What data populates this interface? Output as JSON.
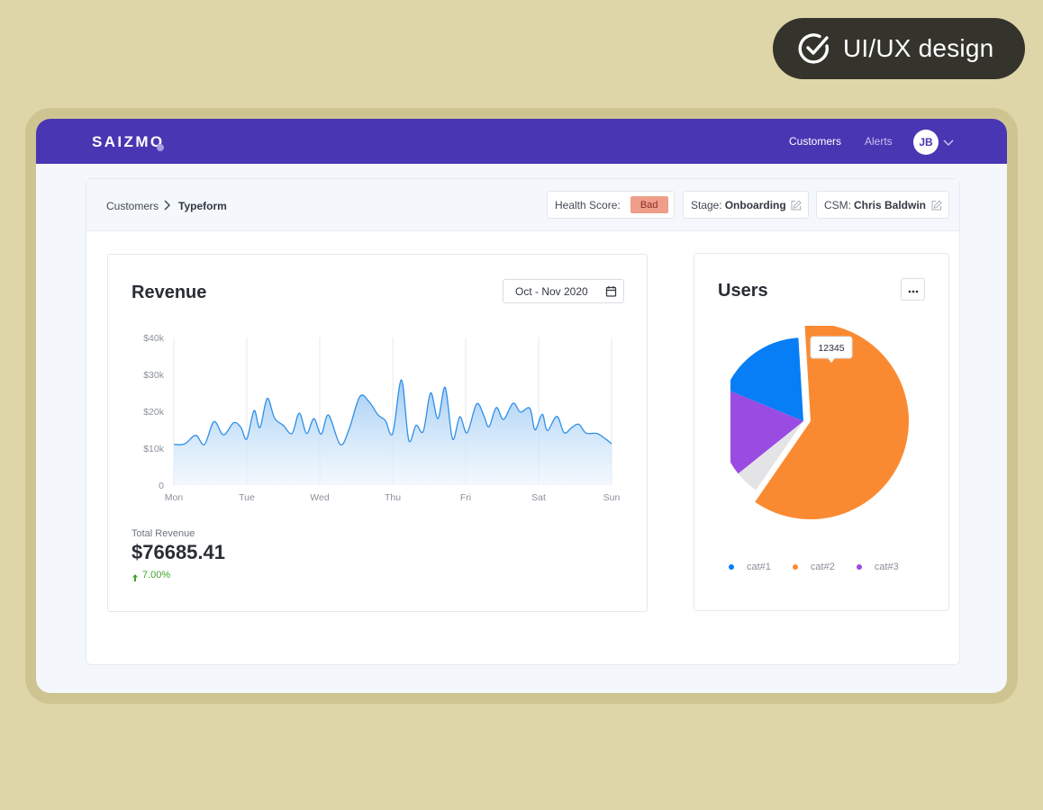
{
  "badge": {
    "label": "UI/UX design",
    "icon": "check-circle-icon"
  },
  "topbar": {
    "logo": "SAIZMO",
    "nav": [
      {
        "label": "Customers"
      },
      {
        "label": "Alerts"
      }
    ],
    "avatar_initials": "JB",
    "avatar_menu_icon": "chevron-down-icon",
    "brand_color": "#4936b2"
  },
  "breadcrumb": {
    "parent": "Customers",
    "current": "Typeform"
  },
  "status": {
    "health": {
      "label": "Health Score:",
      "value": "Bad",
      "color": "#ef9e8a"
    },
    "stage": {
      "label": "Stage:",
      "value": "Onboarding"
    },
    "csm": {
      "label": "CSM:",
      "value": "Chris Baldwin"
    }
  },
  "revenue": {
    "title": "Revenue",
    "date_range": "Oct - Nov 2020",
    "total_label": "Total Revenue",
    "total_value": "$76685.41",
    "change": "7.00%",
    "change_color": "#3fa42b"
  },
  "users": {
    "title": "Users",
    "more_label": "···"
  },
  "chart_data": [
    {
      "type": "area",
      "x_labels": [
        "Mon",
        "Tue",
        "Wed",
        "Thu",
        "Fri",
        "Sat",
        "Sun"
      ],
      "y_ticks": [
        "0",
        "$10k",
        "$20k",
        "$30k",
        "$40k"
      ],
      "ylim": [
        0,
        40000
      ],
      "grid": "vertical",
      "color": "#2f8fe8",
      "points": [
        [
          0,
          11000
        ],
        [
          0.15,
          11200
        ],
        [
          0.3,
          13500
        ],
        [
          0.42,
          11000
        ],
        [
          0.55,
          17200
        ],
        [
          0.68,
          13600
        ],
        [
          0.82,
          16900
        ],
        [
          0.92,
          15600
        ],
        [
          1.0,
          12500
        ],
        [
          1.1,
          20200
        ],
        [
          1.18,
          15600
        ],
        [
          1.28,
          23500
        ],
        [
          1.38,
          18200
        ],
        [
          1.5,
          16200
        ],
        [
          1.62,
          14000
        ],
        [
          1.72,
          19500
        ],
        [
          1.82,
          14000
        ],
        [
          1.92,
          18000
        ],
        [
          2.02,
          13800
        ],
        [
          2.12,
          19000
        ],
        [
          2.28,
          11000
        ],
        [
          2.4,
          15000
        ],
        [
          2.55,
          24000
        ],
        [
          2.68,
          22500
        ],
        [
          2.8,
          19000
        ],
        [
          2.9,
          17500
        ],
        [
          3.0,
          14000
        ],
        [
          3.12,
          28500
        ],
        [
          3.22,
          12200
        ],
        [
          3.32,
          16200
        ],
        [
          3.42,
          14600
        ],
        [
          3.52,
          25000
        ],
        [
          3.62,
          18000
        ],
        [
          3.72,
          26500
        ],
        [
          3.82,
          12500
        ],
        [
          3.92,
          18500
        ],
        [
          4.02,
          14200
        ],
        [
          4.15,
          22000
        ],
        [
          4.25,
          18800
        ],
        [
          4.32,
          15800
        ],
        [
          4.42,
          21000
        ],
        [
          4.52,
          17800
        ],
        [
          4.65,
          22200
        ],
        [
          4.75,
          19800
        ],
        [
          4.88,
          20800
        ],
        [
          4.95,
          15000
        ],
        [
          5.05,
          19200
        ],
        [
          5.12,
          14800
        ],
        [
          5.25,
          18600
        ],
        [
          5.35,
          14200
        ],
        [
          5.45,
          15500
        ],
        [
          5.55,
          16500
        ],
        [
          5.65,
          14100
        ],
        [
          5.8,
          14000
        ],
        [
          5.92,
          12500
        ],
        [
          6.0,
          11200
        ]
      ]
    },
    {
      "type": "pie",
      "labels": [
        "cat#1",
        "cat#2",
        "cat#3"
      ],
      "colors": [
        "#077ef5",
        "#fa8a32",
        "#9a4ce2"
      ],
      "slices": [
        {
          "label": "cat#1",
          "value": 12345,
          "color": "#077ef5",
          "tooltip": "12345"
        },
        {
          "label": "cat#2",
          "value": 42000,
          "color": "#fa8a32"
        },
        {
          "label": "",
          "value": 3200,
          "color": "#e4e4e6"
        },
        {
          "label": "cat#3",
          "value": 11800,
          "color": "#9a4ce2"
        }
      ]
    }
  ]
}
